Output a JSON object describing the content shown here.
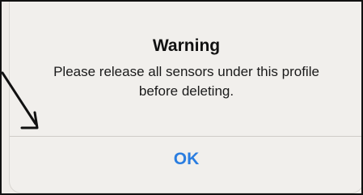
{
  "alert": {
    "title": "Warning",
    "message": "Please release all sensors under this profile before deleting.",
    "ok_label": "OK"
  },
  "annotation": {
    "icon": "pointer-arrow-icon",
    "color": "#111111"
  },
  "colors": {
    "button_text": "#2a7de0",
    "alert_background": "#f1efec"
  }
}
